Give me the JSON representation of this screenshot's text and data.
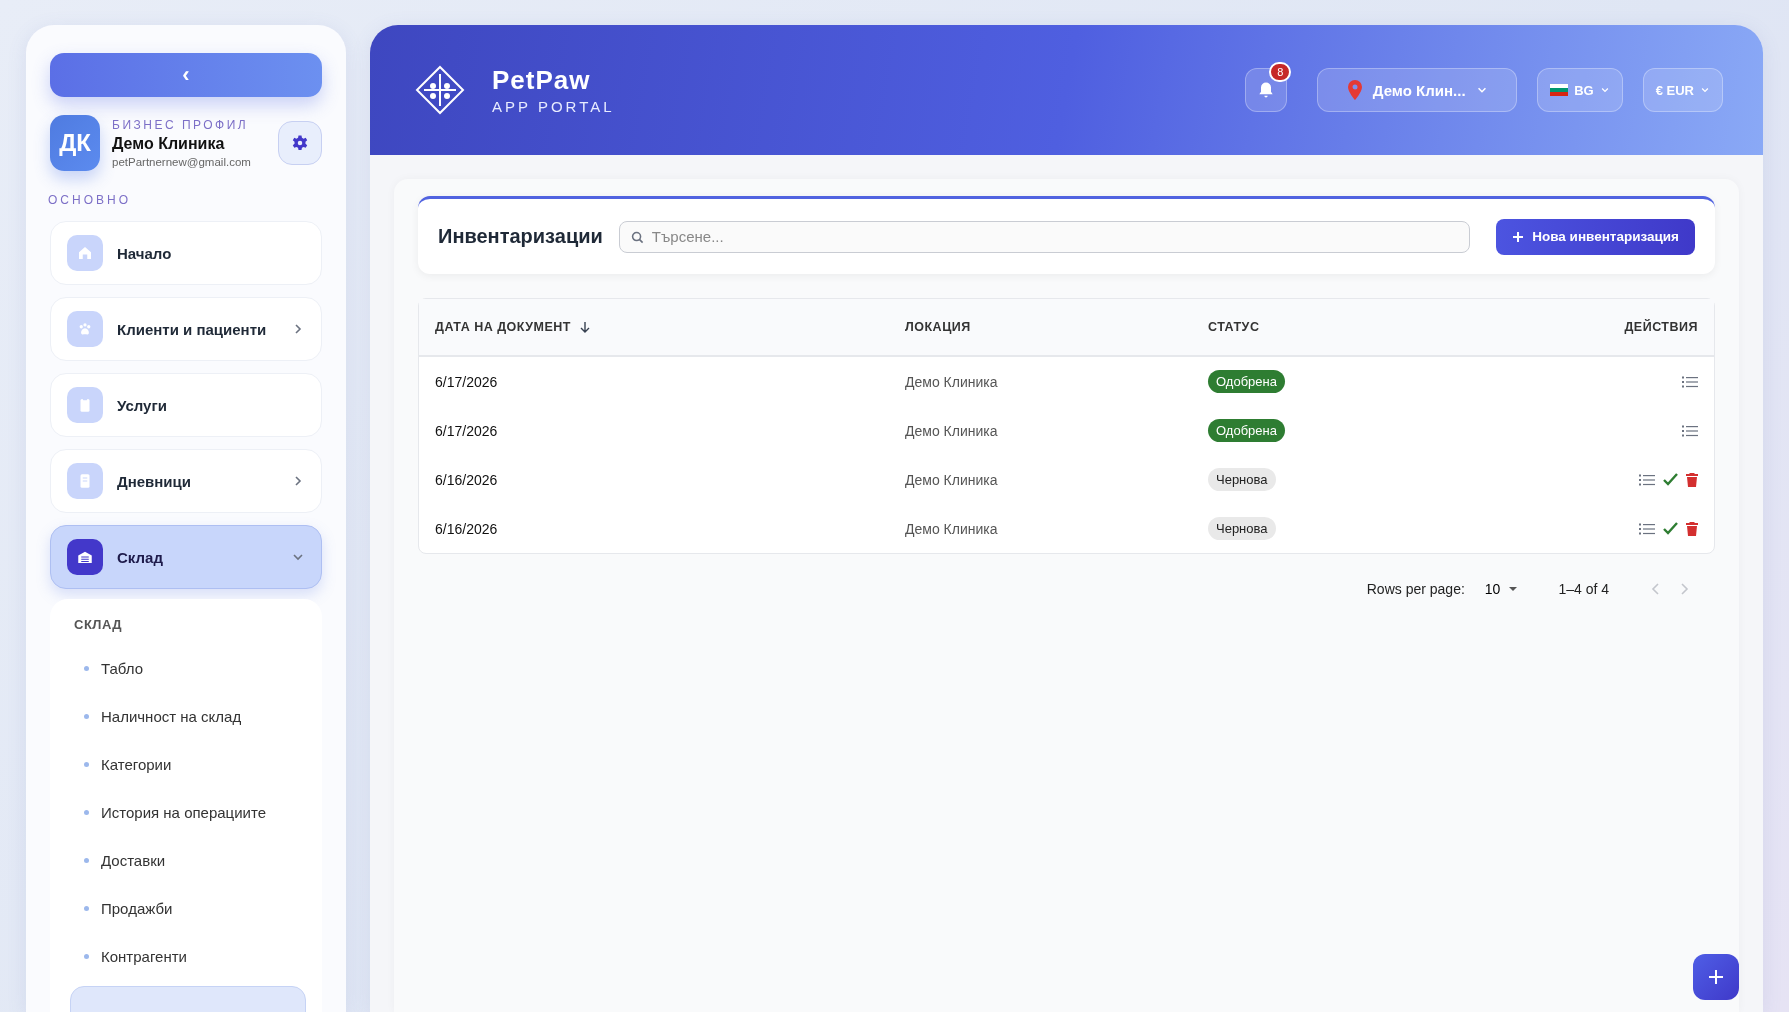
{
  "sidebar": {
    "collapse_button": "‹",
    "profile": {
      "avatar": "ДК",
      "label": "БИЗНЕС ПРОФИЛ",
      "name": "Демо Клиника",
      "email": "petPartnernew@gmail.com"
    },
    "section": "ОСНОВНО",
    "items": [
      {
        "label": "Начало",
        "selected": false,
        "kind": "link"
      },
      {
        "label": "Клиенти и пациенти",
        "selected": false,
        "kind": "group",
        "expanded": false
      },
      {
        "label": "Услуги",
        "selected": false,
        "kind": "link"
      },
      {
        "label": "Дневници",
        "selected": false,
        "kind": "group",
        "expanded": false
      },
      {
        "label": "Склад",
        "selected": true,
        "kind": "group",
        "expanded": true
      }
    ],
    "submenu": {
      "title": "СКЛАД",
      "items": [
        {
          "label": "Табло",
          "selected": false
        },
        {
          "label": "Наличност на склад",
          "selected": false
        },
        {
          "label": "Категории",
          "selected": false
        },
        {
          "label": "История на операциите",
          "selected": false
        },
        {
          "label": "Доставки",
          "selected": false
        },
        {
          "label": "Продажби",
          "selected": false
        },
        {
          "label": "Контрагенти",
          "selected": false
        },
        {
          "selected": true
        }
      ]
    }
  },
  "header": {
    "brand": "PetPaw",
    "subtitle": "APP PORTAL",
    "notifications": "8",
    "location": "Демо Клин...",
    "language": "BG",
    "currency": "€ EUR"
  },
  "page": {
    "title": "Инвентаризации",
    "search": {
      "placeholder": "Търсене..."
    },
    "new_button": "Нова инвентаризация"
  },
  "table": {
    "columns": [
      "ДАТА НА ДОКУМЕНТ",
      "ЛОКАЦИЯ",
      "СТАТУС",
      "ДЕЙСТВИЯ"
    ],
    "sort_descending": true,
    "rows": [
      {
        "date": "6/17/2026",
        "location": "Демо Клиника",
        "status": {
          "label": "Одобрена",
          "kind": "approved"
        },
        "can_approve": false,
        "can_delete": false
      },
      {
        "date": "6/17/2026",
        "location": "Демо Клиника",
        "status": {
          "label": "Одобрена",
          "kind": "approved"
        },
        "can_approve": false,
        "can_delete": false
      },
      {
        "date": "6/16/2026",
        "location": "Демо Клиника",
        "status": {
          "label": "Чернова",
          "kind": "draft"
        },
        "can_approve": true,
        "can_delete": true
      },
      {
        "date": "6/16/2026",
        "location": "Демо Клиника",
        "status": {
          "label": "Чернова",
          "kind": "draft"
        },
        "can_approve": true,
        "can_delete": true
      }
    ]
  },
  "pagination": {
    "rows_per_page_label": "Rows per page:",
    "rows_per_page": "10",
    "range": "1–4 of 4",
    "prev_disabled": true,
    "next_disabled": true
  }
}
